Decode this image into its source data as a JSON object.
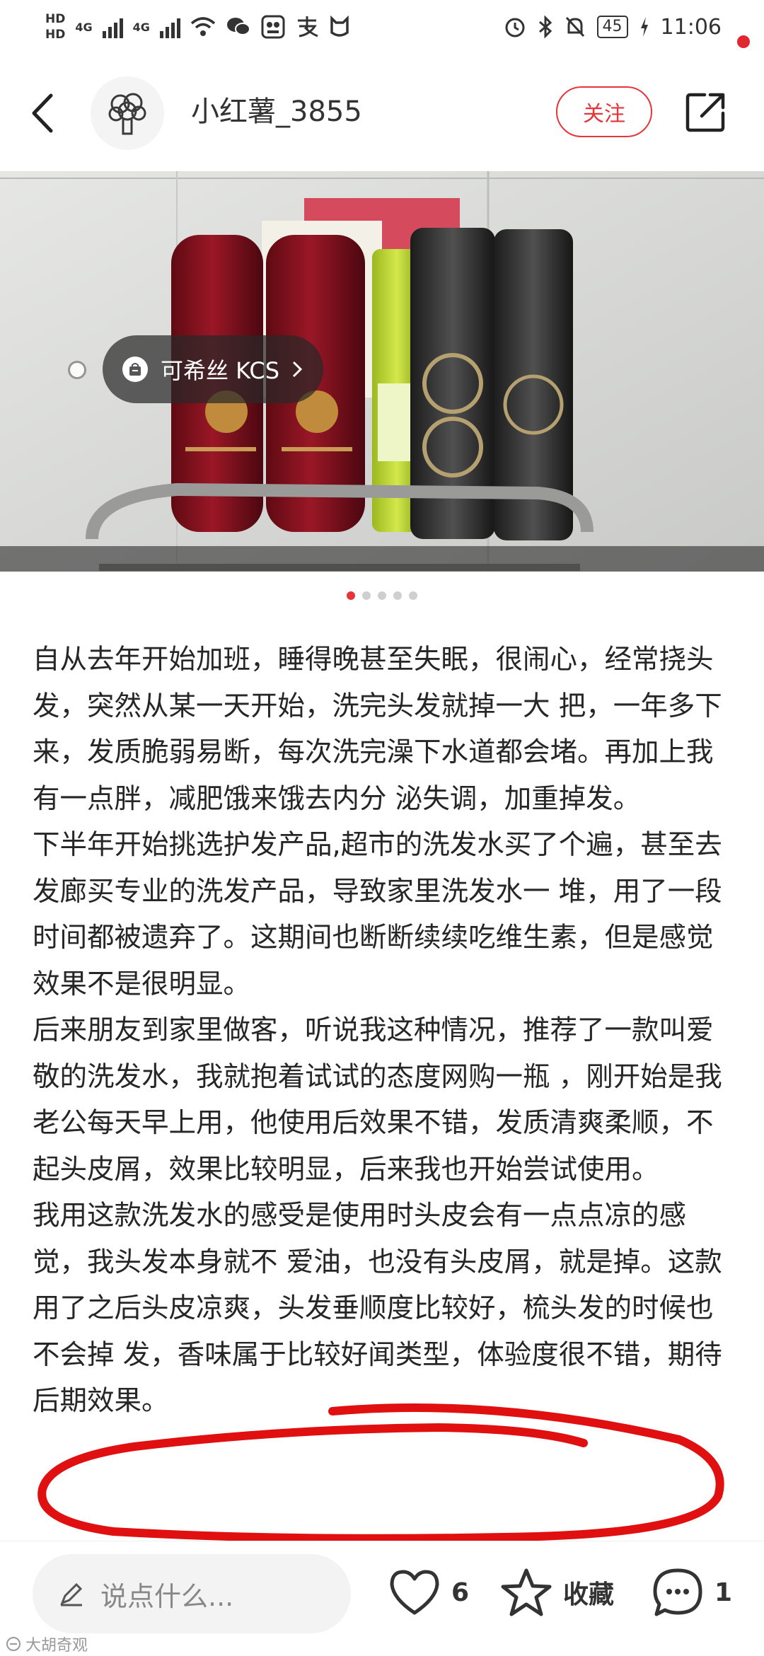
{
  "status_bar": {
    "hd1": "HD",
    "hd2": "HD",
    "net1": "4G",
    "net2": "4G",
    "battery": "45",
    "time": "11:06"
  },
  "header": {
    "username": "小红薯_3855",
    "follow_label": "关注"
  },
  "photo": {
    "tag_label": "可希丝 KCS"
  },
  "carousel": {
    "total": 5,
    "active_index": 0
  },
  "post": {
    "paragraphs": [
      "自从去年开始加班，睡得晚甚至失眠，很闹心，经常挠头发，突然从某一天开始，洗完头发就掉一大 把，一年多下来，发质脆弱易断，每次洗完澡下水道都会堵。再加上我有一点胖，减肥饿来饿去内分 泌失调，加重掉发。",
      "下半年开始挑选护发产品,超市的洗发水买了个遍，甚至去发廊买专业的洗发产品，导致家里洗发水一 堆，用了一段时间都被遗弃了。这期间也断断续续吃维生素，但是感觉效果不是很明显。",
      "后来朋友到家里做客，听说我这种情况，推荐了一款叫爱敬的洗发水，我就抱着试试的态度网购一瓶 ，刚开始是我老公每天早上用，他使用后效果不错，发质清爽柔顺，不起头皮屑，效果比较明显，后来我也开始尝试使用。",
      "我用这款洗发水的感受是使用时头皮会有一点点凉的感觉，我头发本身就不 爱油，也没有头皮屑，就是掉。这款用了之后头皮凉爽，头发垂顺度比较好，梳头发的时候也不会掉 发，香味属于比较好闻类型，体验度很不错，期待后期效果。"
    ]
  },
  "bottom_bar": {
    "comment_placeholder": "说点什么...",
    "like_count": "6",
    "collect_label": "收藏",
    "comment_count": "1"
  },
  "watermark": "大胡奇观",
  "colors": {
    "accent_red": "#e6353a",
    "annotation_red": "#e01010"
  }
}
